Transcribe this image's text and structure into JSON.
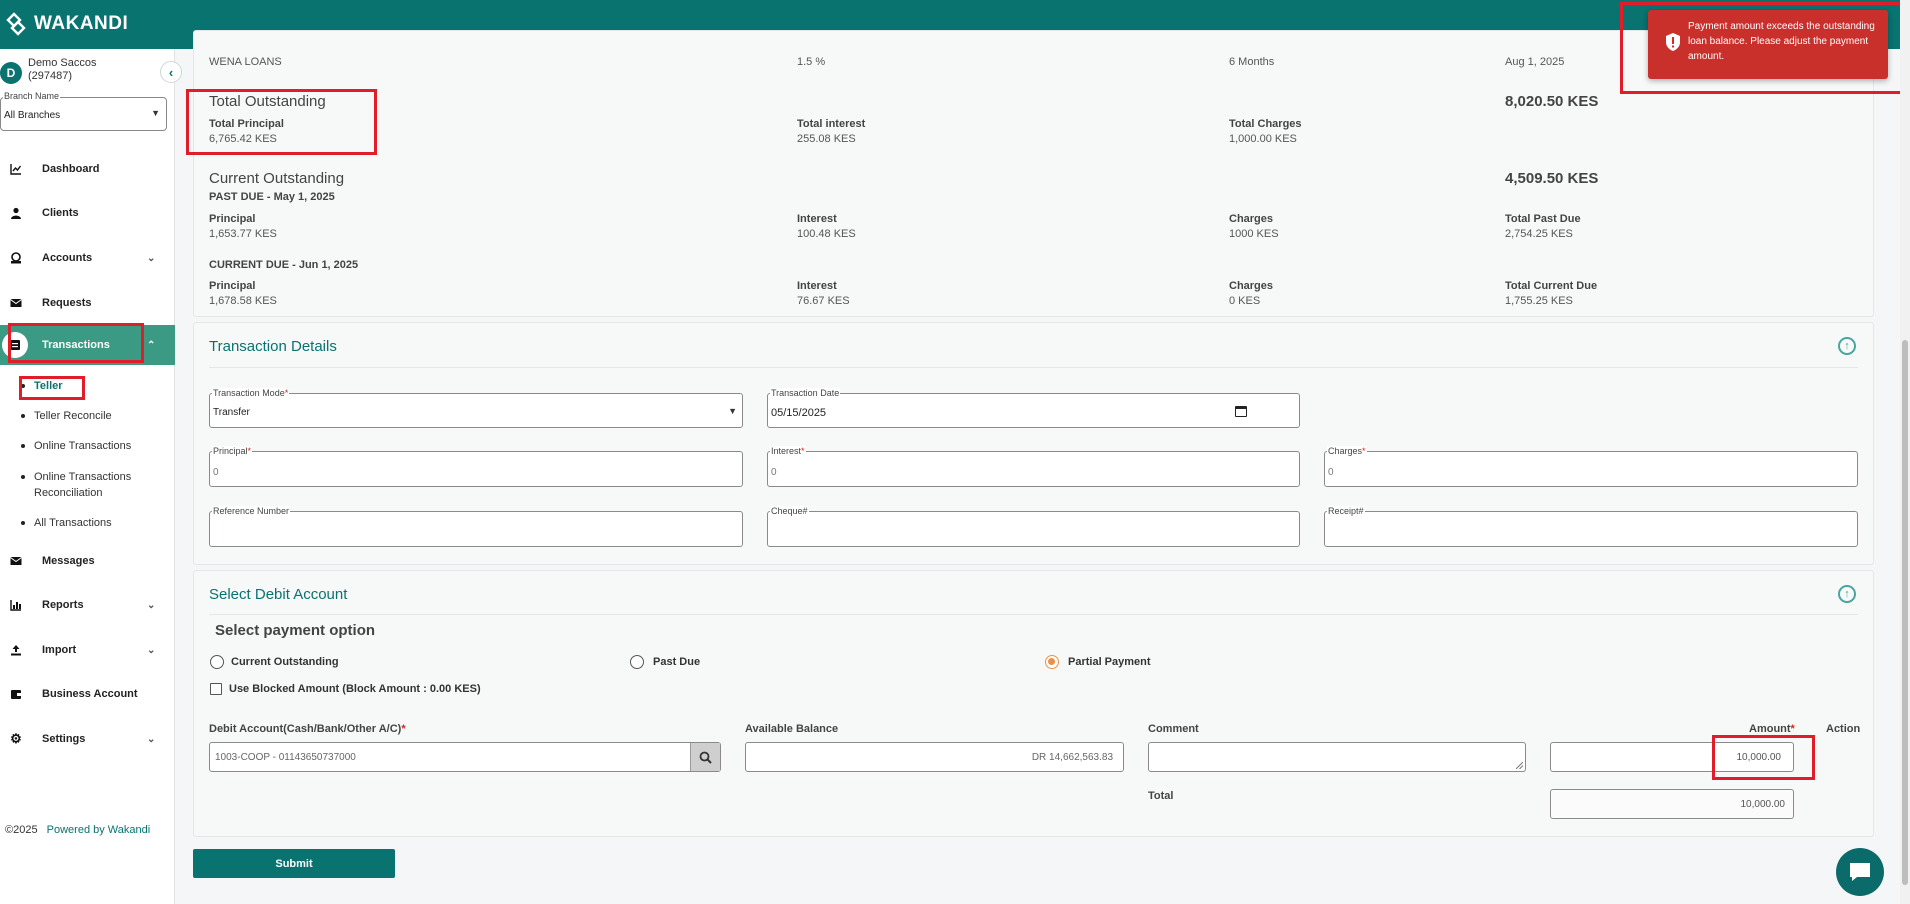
{
  "app": {
    "name": "WAKANDI"
  },
  "org": {
    "initial": "D",
    "name": "Demo Saccos",
    "code": "(297487)"
  },
  "branch": {
    "label": "Branch Name",
    "value": "All Branches"
  },
  "nav": [
    {
      "label": "Dashboard",
      "icon": "chart-line-icon"
    },
    {
      "label": "Clients",
      "icon": "user-icon"
    },
    {
      "label": "Accounts",
      "icon": "account-icon"
    },
    {
      "label": "Requests",
      "icon": "mail-icon"
    },
    {
      "label": "Transactions",
      "icon": "wallet-icon"
    },
    {
      "label": "Messages",
      "icon": "envelope-icon"
    },
    {
      "label": "Reports",
      "icon": "bar-chart-icon"
    },
    {
      "label": "Import",
      "icon": "upload-icon"
    },
    {
      "label": "Business Account",
      "icon": "briefcase-icon"
    },
    {
      "label": "Settings",
      "icon": "gear-icon"
    }
  ],
  "subnav": [
    "Teller",
    "Teller Reconcile",
    "Online Transactions",
    "Online Transactions Reconciliation",
    "All Transactions"
  ],
  "footer": {
    "copyright": "©2025",
    "powered": "Powered by Wakandi"
  },
  "loan": {
    "product_name": "WENA LOANS",
    "interest_rate": "1.5 %",
    "tenure": "6 Months",
    "expiry_date": "Aug 1, 2025"
  },
  "total_outstanding": {
    "title": "Total Outstanding",
    "amount": "8,020.50 KES",
    "principal_label": "Total Principal",
    "principal": "6,765.42 KES",
    "interest_label": "Total interest",
    "interest": "255.08 KES",
    "charges_label": "Total Charges",
    "charges": "1,000.00 KES"
  },
  "current_outstanding": {
    "title": "Current Outstanding",
    "amount": "4,509.50 KES",
    "past_due_heading": "PAST DUE - May 1, 2025",
    "past": {
      "principal_label": "Principal",
      "principal": "1,653.77 KES",
      "interest_label": "Interest",
      "interest": "100.48 KES",
      "charges_label": "Charges",
      "charges": "1000 KES",
      "total_label": "Total Past Due",
      "total": "2,754.25 KES"
    },
    "current_due_heading": "CURRENT DUE - Jun 1, 2025",
    "current": {
      "principal_label": "Principal",
      "principal": "1,678.58 KES",
      "interest_label": "Interest",
      "interest": "76.67 KES",
      "charges_label": "Charges",
      "charges": "0 KES",
      "total_label": "Total Current Due",
      "total": "1,755.25 KES"
    }
  },
  "transaction_details": {
    "title": "Transaction Details",
    "mode_label": "Transaction Mode",
    "mode": "Transfer",
    "date_label": "Transaction Date",
    "date": "05/15/2025",
    "principal_label": "Principal",
    "principal": "0",
    "interest_label": "Interest",
    "interest": "0",
    "charges_label": "Charges",
    "charges": "0",
    "reference_label": "Reference Number",
    "cheque_label": "Cheque#",
    "receipt_label": "Receipt#"
  },
  "debit": {
    "title": "Select Debit Account",
    "payment_option_title": "Select payment option",
    "options": [
      "Current Outstanding",
      "Past Due",
      "Partial Payment"
    ],
    "selected_option": "Partial Payment",
    "blocked_label": "Use Blocked Amount (Block Amount : 0.00 KES)",
    "debit_account_label": "Debit Account(Cash/Bank/Other A/C)",
    "debit_account_value": "1003-COOP - 01143650737000",
    "available_balance_label": "Available Balance",
    "available_balance": "DR 14,662,563.83",
    "comment_label": "Comment",
    "amount_label": "Amount",
    "action_label": "Action",
    "amount": "10,000.00",
    "total_label": "Total",
    "total": "10,000.00"
  },
  "submit_label": "Submit",
  "toast": {
    "message": "Payment amount exceeds the outstanding loan balance. Please adjust the payment amount."
  },
  "colors": {
    "brand": "#08736f",
    "active_nav": "#3a9a83",
    "toast": "#c9302c",
    "highlight": "#e11d2a",
    "radio": "#e8914a"
  }
}
